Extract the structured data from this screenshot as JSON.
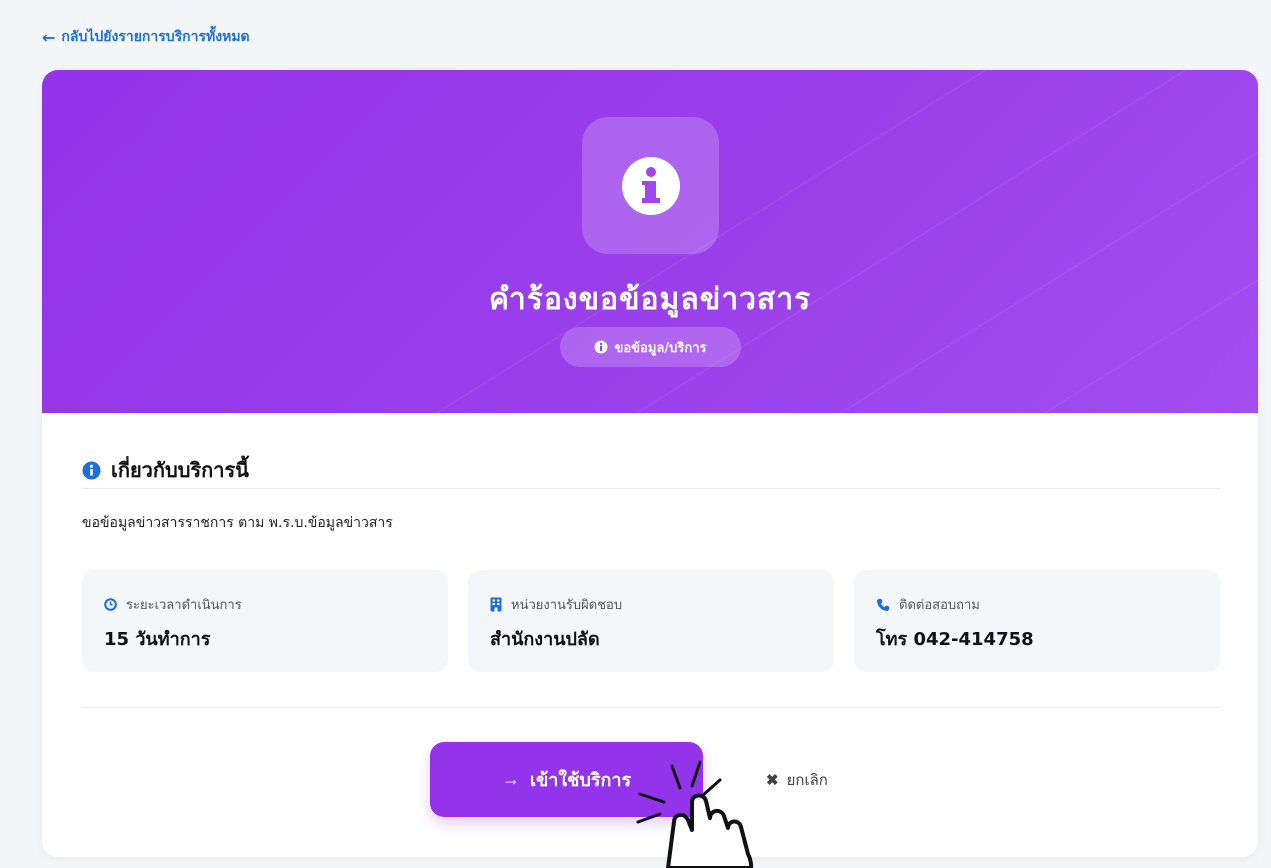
{
  "nav": {
    "back_label": "กลับไปยังรายการบริการทั้งหมด"
  },
  "hero": {
    "icon": "info-circle-icon",
    "title": "คำร้องขอข้อมูลข่าวสาร",
    "category": "ขอข้อมูล/บริการ"
  },
  "about": {
    "heading": "เกี่ยวกับบริการนี้",
    "description": "ขอข้อมูลข่าวสารราชการ ตาม พ.ร.บ.ข้อมูลข่าวสาร"
  },
  "info_cards": [
    {
      "icon": "clock-icon",
      "label": "ระยะเวลาดำเนินการ",
      "value": "15 วันทำการ"
    },
    {
      "icon": "building-icon",
      "label": "หน่วยงานรับผิดชอบ",
      "value": "สำนักงานปลัด"
    },
    {
      "icon": "phone-icon",
      "label": "ติดต่อสอบถาม",
      "value": "โทร 042-414758"
    }
  ],
  "actions": {
    "primary_label": "เข้าใช้บริการ",
    "cancel_label": "ยกเลิก"
  },
  "colors": {
    "accent": "#9333ea",
    "link": "#1e6fd9",
    "card_bg": "#f4f7f9"
  }
}
